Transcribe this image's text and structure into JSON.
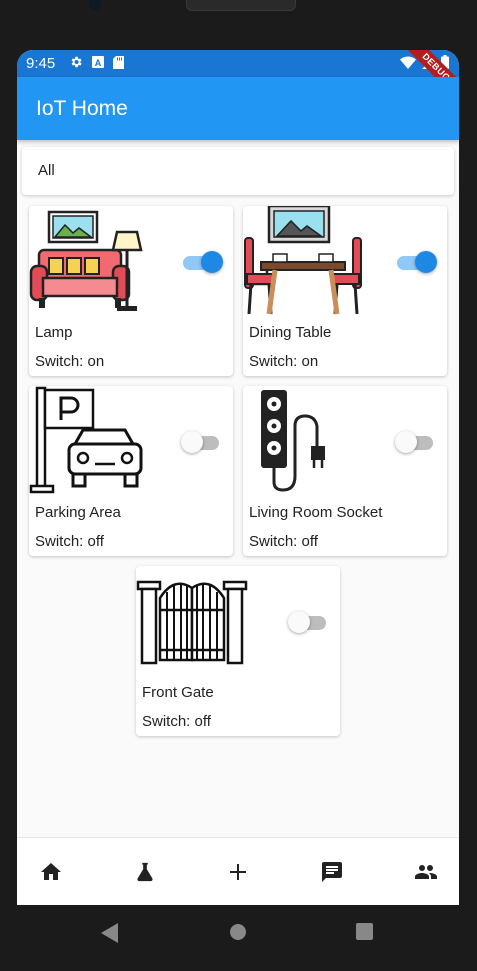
{
  "status_bar": {
    "time": "9:45",
    "debug_label": "DEBUG"
  },
  "app_bar": {
    "title": "IoT Home"
  },
  "filter": {
    "selected": "All"
  },
  "devices": [
    {
      "name": "Lamp",
      "status": "Switch: on",
      "icon": "living-room-sofa-lamp-icon",
      "on": true
    },
    {
      "name": "Dining Table",
      "status": "Switch: on",
      "icon": "dining-table-icon",
      "on": true
    },
    {
      "name": "Parking Area",
      "status": "Switch: off",
      "icon": "parking-car-icon",
      "on": false
    },
    {
      "name": "Living Room Socket",
      "status": "Switch: off",
      "icon": "power-socket-icon",
      "on": false
    },
    {
      "name": "Front Gate",
      "status": "Switch: off",
      "icon": "gate-icon",
      "on": false
    }
  ],
  "bottom_nav": [
    "home-icon",
    "flask-icon",
    "add-icon",
    "chat-icon",
    "people-icon"
  ],
  "colors": {
    "appbar": "#2196f3",
    "statusbar": "#1976d2",
    "toggle_on": "#1e88e5"
  }
}
